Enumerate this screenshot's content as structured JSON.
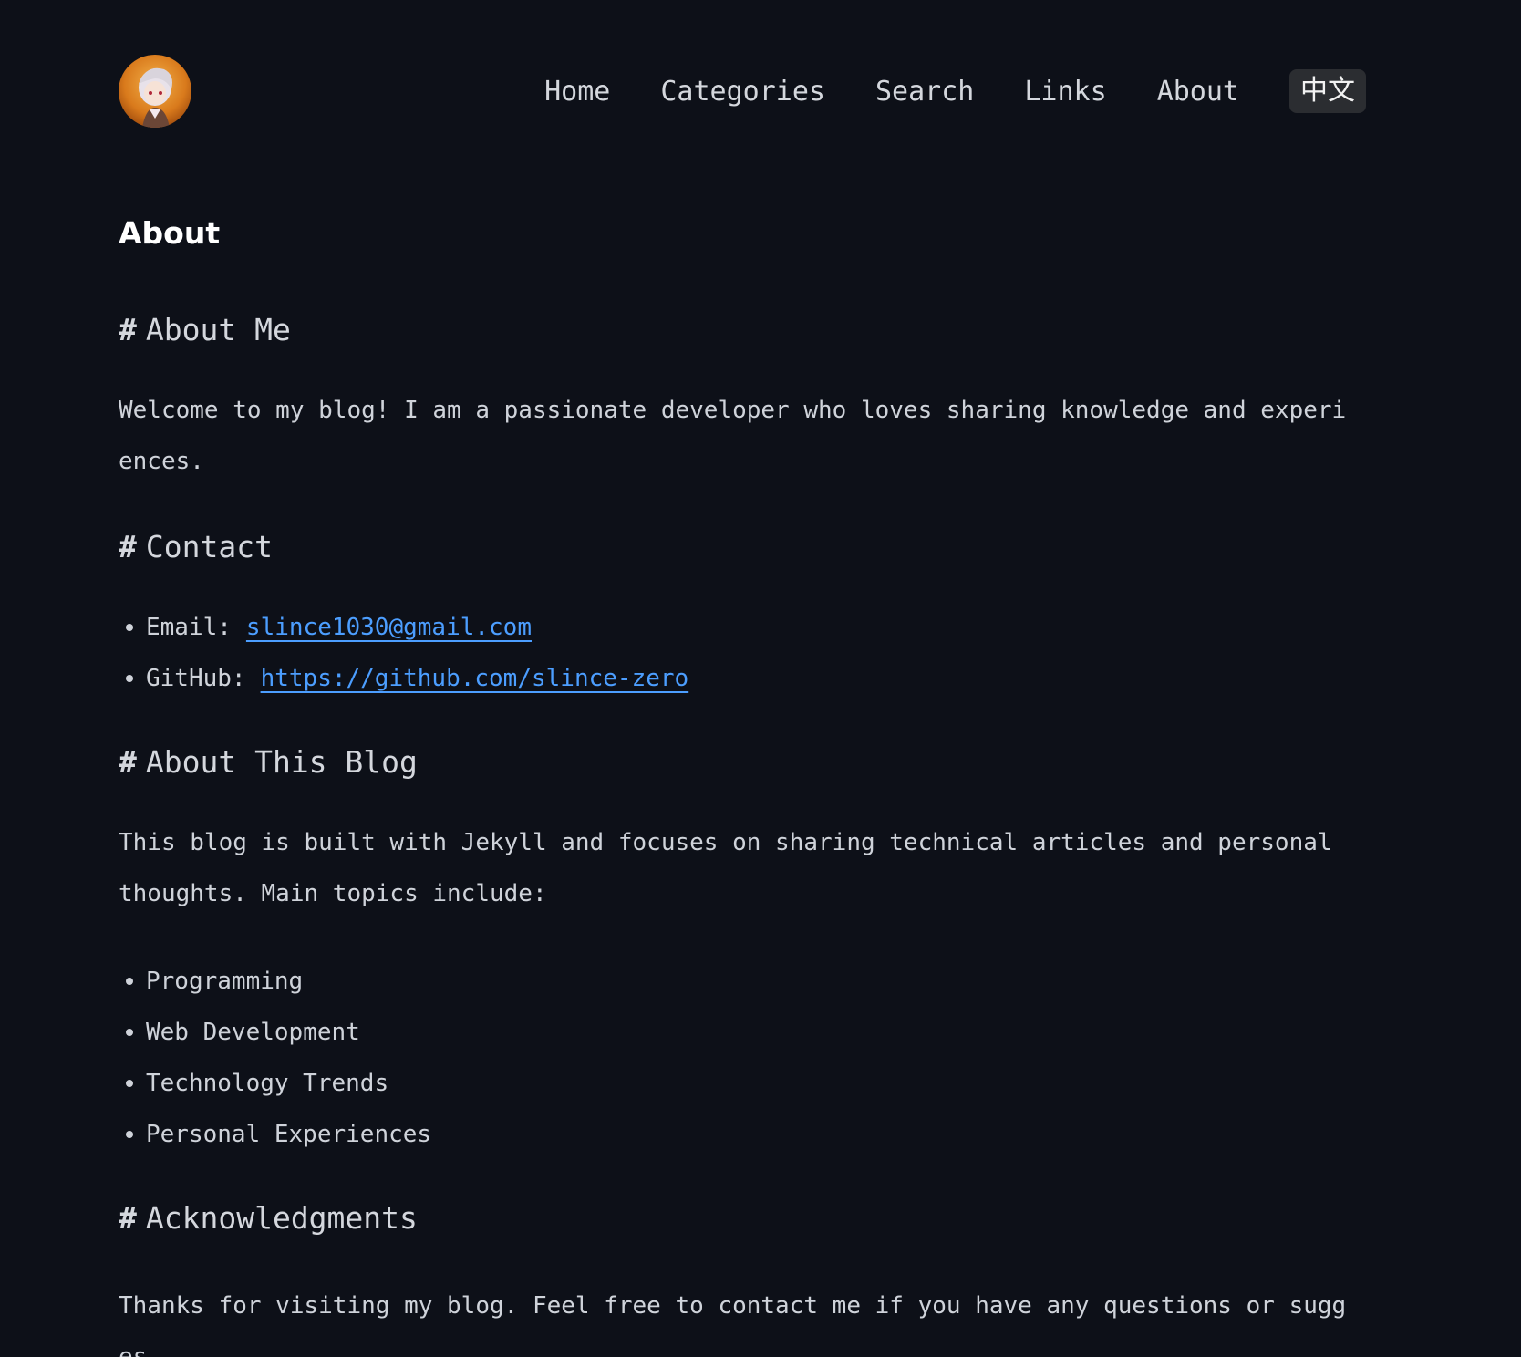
{
  "header": {
    "avatar_alt": "avatar",
    "nav": [
      {
        "label": "Home"
      },
      {
        "label": "Categories"
      },
      {
        "label": "Search"
      },
      {
        "label": "Links"
      },
      {
        "label": "About"
      }
    ],
    "lang_toggle": "中文"
  },
  "page": {
    "title": "About"
  },
  "sections": {
    "about_me": {
      "heading": "About Me",
      "text": "Welcome to my blog! I am a passionate developer who loves sharing knowledge and experiences."
    },
    "contact": {
      "heading": "Contact",
      "email_label": "Email:",
      "email": "slince1030@gmail.com",
      "github_label": "GitHub:",
      "github": "https://github.com/slince-zero"
    },
    "about_blog": {
      "heading": "About This Blog",
      "text": "This blog is built with Jekyll and focuses on sharing technical articles and personal thoughts. Main topics include:",
      "topics": [
        "Programming",
        "Web Development",
        "Technology Trends",
        "Personal Experiences"
      ]
    },
    "acknowledgments": {
      "heading": "Acknowledgments",
      "text": "Thanks for visiting my blog. Feel free to contact me if you have any questions or sugges"
    }
  },
  "colors": {
    "background": "#0d1018",
    "text": "#cfd3da",
    "link": "#4c9eff",
    "toggle_bg": "#2b2d31"
  },
  "icons": {
    "avatar": "anime-avatar-image"
  }
}
